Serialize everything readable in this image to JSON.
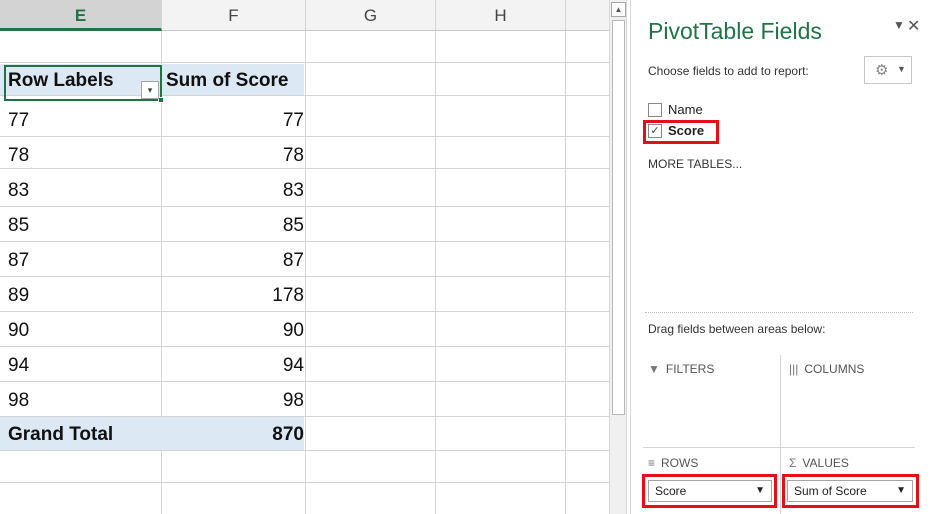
{
  "sheet": {
    "columns": [
      "E",
      "F",
      "G",
      "H"
    ],
    "active_column": "E",
    "header_row": {
      "row_labels": "Row Labels",
      "sum_label": "Sum of Score"
    },
    "rows": [
      {
        "label": "77",
        "value": "77"
      },
      {
        "label": "78",
        "value": "78"
      },
      {
        "label": "83",
        "value": "83"
      },
      {
        "label": "85",
        "value": "85"
      },
      {
        "label": "87",
        "value": "87"
      },
      {
        "label": "89",
        "value": "178"
      },
      {
        "label": "90",
        "value": "90"
      },
      {
        "label": "94",
        "value": "94"
      },
      {
        "label": "98",
        "value": "98"
      }
    ],
    "grand_total": {
      "label": "Grand Total",
      "value": "870"
    },
    "filter_icon": "dropdown-filter-icon"
  },
  "pane": {
    "title": "PivotTable Fields",
    "choose_text": "Choose fields to add to report:",
    "fields": [
      {
        "name": "Name",
        "checked": false
      },
      {
        "name": "Score",
        "checked": true
      }
    ],
    "more_tables": "MORE TABLES...",
    "drag_text": "Drag fields between areas below:",
    "areas": {
      "filters": "FILTERS",
      "columns": "COLUMNS",
      "rows": "ROWS",
      "values": "VALUES"
    },
    "rows_field": "Score",
    "values_field": "Sum of Score",
    "icons": {
      "filter": "funnel-icon",
      "columns": "columns-icon",
      "rows": "rows-icon",
      "values": "sigma-icon",
      "settings": "gear-icon"
    }
  },
  "colors": {
    "accent": "#217346",
    "highlight": "#e3101a",
    "pivot_band": "#dce8f4"
  }
}
